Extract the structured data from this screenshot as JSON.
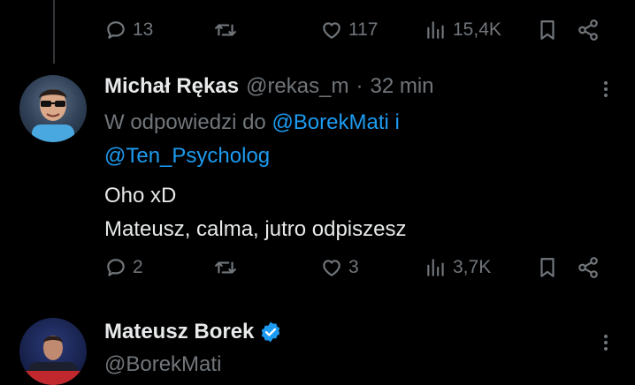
{
  "top_tweet": {
    "reply_count": "13",
    "like_count": "117",
    "view_count": "15,4K"
  },
  "reply_tweet": {
    "author_name": "Michał Rękas",
    "handle": "@rekas_m",
    "separator": "·",
    "time": "32 min",
    "replying_prefix": "W odpowiedzi do",
    "mention_1": "@BorekMati",
    "conjunction": "i",
    "mention_2": "@Ten_Psycholog",
    "text_line_1": "Oho xD",
    "text_line_2": "Mateusz, calma, jutro odpiszesz",
    "reply_count": "2",
    "like_count": "3",
    "view_count": "3,7K"
  },
  "next_tweet": {
    "author_name": "Mateusz Borek",
    "handle": "@BorekMati",
    "verified_color": "#1d9bf0"
  },
  "icons": [
    "reply-icon",
    "retweet-icon",
    "like-icon",
    "views-icon",
    "bookmark-icon",
    "share-icon",
    "more-icon",
    "verified-icon"
  ]
}
